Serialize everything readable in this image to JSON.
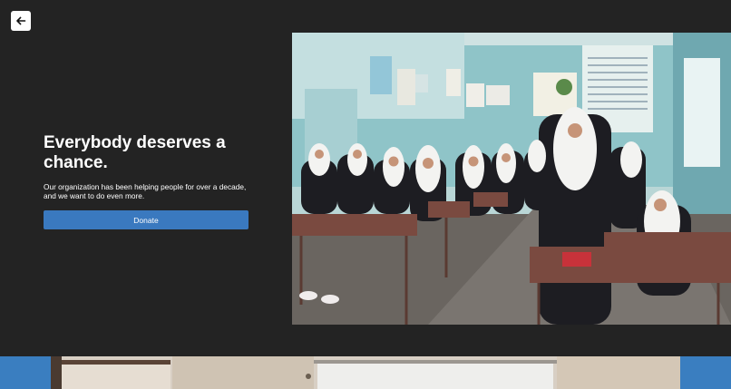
{
  "nav": {
    "back_icon": "arrow-left-icon"
  },
  "hero": {
    "headline": "Everybody deserves a chance.",
    "body": "Our organization has been helping people for over a decade, and we want to do even more.",
    "donate_label": "Donate",
    "accent_color": "#3a79bf",
    "background_color": "#232323"
  },
  "photo": {
    "subject": "classroom-photo"
  },
  "next_section": {
    "subject": "classroom-photo-partial"
  }
}
